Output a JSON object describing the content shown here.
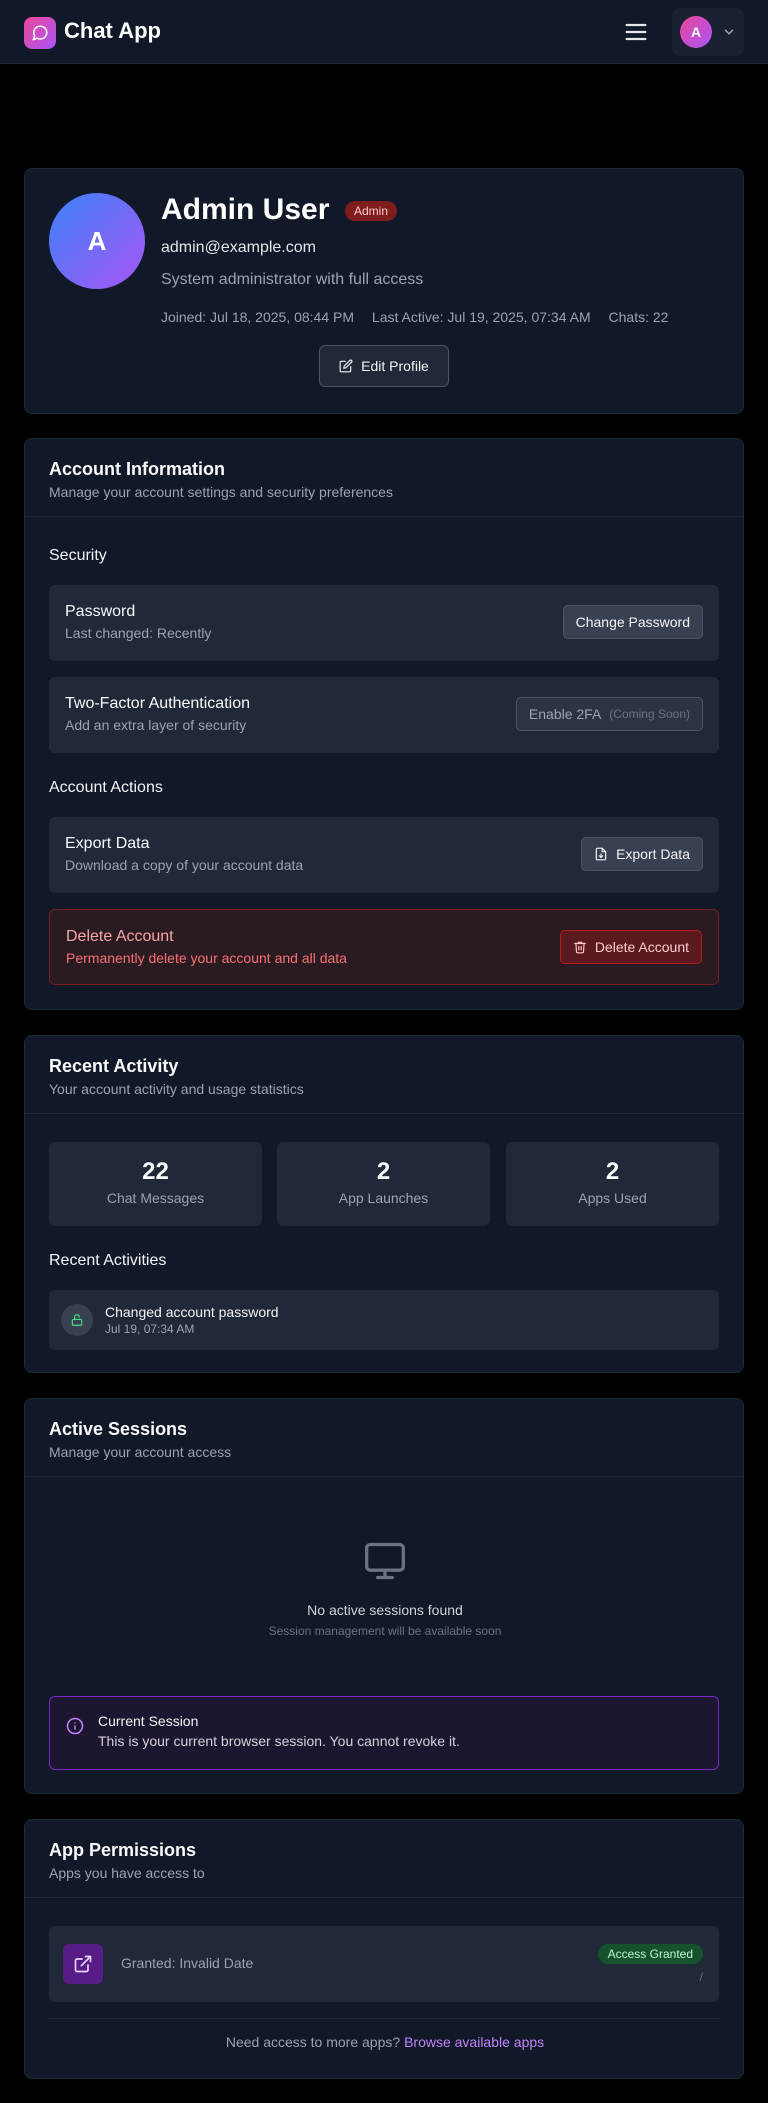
{
  "header": {
    "app_title": "Chat App",
    "user_initial": "A",
    "brand_gradient": [
      "#ec4899",
      "#a855f7"
    ]
  },
  "profile": {
    "initial": "A",
    "name": "Admin User",
    "role_badge": "Admin",
    "email": "admin@example.com",
    "description": "System administrator with full access",
    "joined": "Joined: Jul 18, 2025, 08:44 PM",
    "last_active": "Last Active: Jul 19, 2025, 07:34 AM",
    "chats": "Chats: 22",
    "edit_label": "Edit Profile"
  },
  "account": {
    "title": "Account Information",
    "subtitle": "Manage your account settings and security preferences",
    "security_label": "Security",
    "password_title": "Password",
    "password_sub": "Last changed: Recently",
    "password_btn": "Change Password",
    "twofa_title": "Two-Factor Authentication",
    "twofa_sub": "Add an extra layer of security",
    "twofa_btn": "Enable 2FA",
    "twofa_note": "(Coming Soon)",
    "actions_label": "Account Actions",
    "export_title": "Export Data",
    "export_sub": "Download a copy of your account data",
    "export_btn": "Export Data",
    "delete_title": "Delete Account",
    "delete_sub": "Permanently delete your account and all data",
    "delete_btn": "Delete Account"
  },
  "activity": {
    "title": "Recent Activity",
    "subtitle": "Your account activity and usage statistics",
    "stats": [
      {
        "value": "22",
        "label": "Chat Messages"
      },
      {
        "value": "2",
        "label": "App Launches"
      },
      {
        "value": "2",
        "label": "Apps Used"
      }
    ],
    "recent_label": "Recent Activities",
    "items": [
      {
        "title": "Changed account password",
        "time": "Jul 19, 07:34 AM"
      }
    ]
  },
  "sessions": {
    "title": "Active Sessions",
    "subtitle": "Manage your account access",
    "empty_title": "No active sessions found",
    "empty_sub": "Session management will be available soon",
    "current_title": "Current Session",
    "current_sub": "This is your current browser session. You cannot revoke it."
  },
  "permissions": {
    "title": "App Permissions",
    "subtitle": "Apps you have access to",
    "granted": "Granted: Invalid Date",
    "badge": "Access Granted",
    "slash": "/",
    "footer_text": "Need access to more apps?",
    "footer_link": "Browse available apps"
  }
}
